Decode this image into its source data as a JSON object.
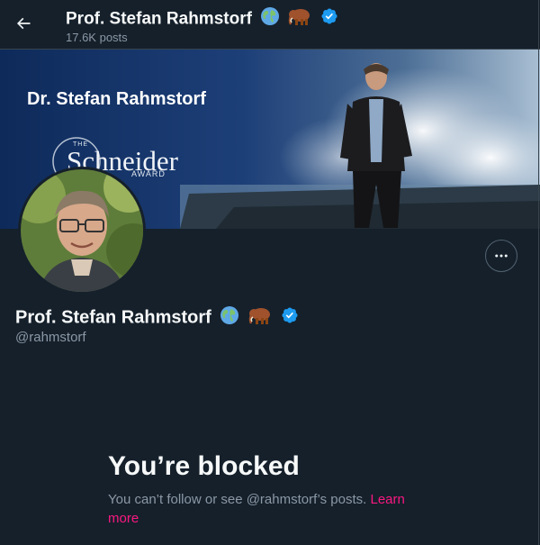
{
  "header": {
    "name": "Prof. Stefan Rahmstorf",
    "posts_count": "17.6K posts",
    "emojis": [
      "globe-icon",
      "mammoth-icon"
    ]
  },
  "banner": {
    "title": "Dr. Stefan Rahmstorf",
    "award_the": "THE",
    "award_name": "Schneider",
    "award_sub": "AWARD"
  },
  "profile": {
    "name": "Prof. Stefan Rahmstorf",
    "handle": "@rahmstorf",
    "verified": true
  },
  "blocked": {
    "title": "You’re blocked",
    "message": "You can’t follow or see @rahmstorf’s posts.",
    "link_text": "Learn more"
  },
  "colors": {
    "background": "#15202b",
    "text": "#f7f9f9",
    "secondary": "#8b98a5",
    "verified_blue": "#1d9bf0",
    "link_pink": "#f91880"
  }
}
